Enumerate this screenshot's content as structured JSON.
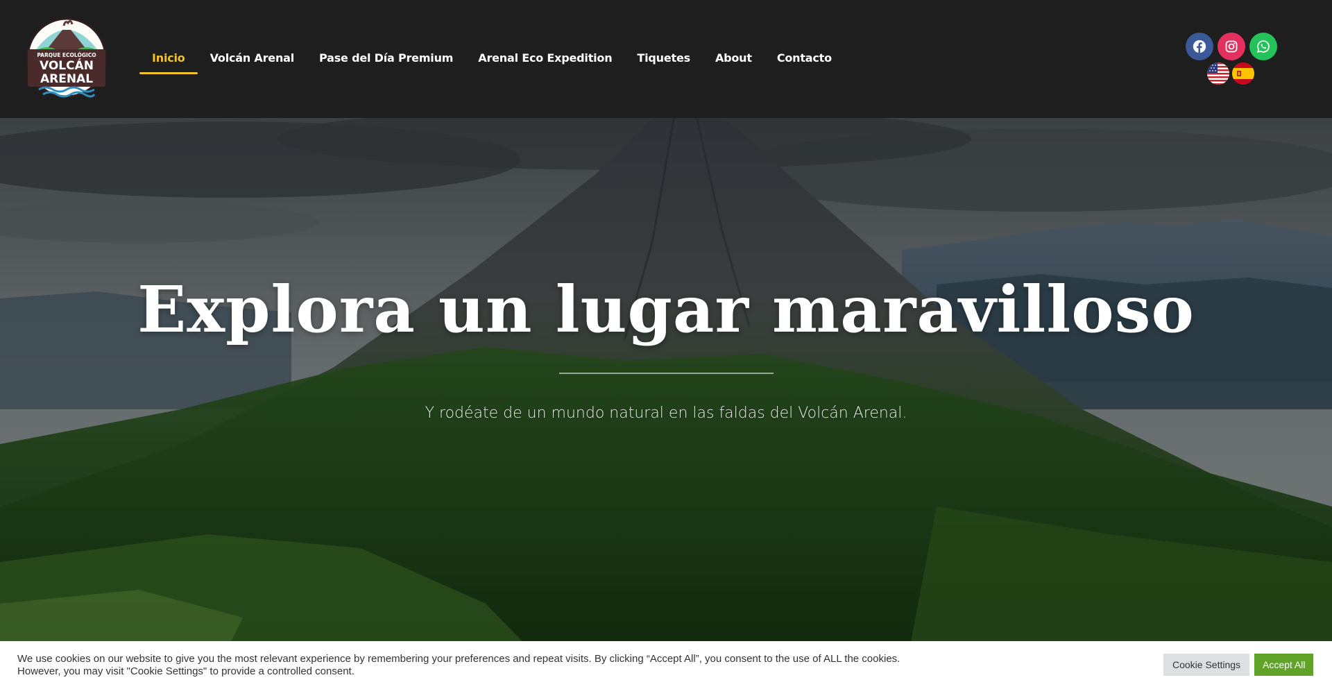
{
  "logo": {
    "line1": "PARQUE ECOLÓGICO",
    "line2": "VOLCÁN",
    "line3": "ARENAL"
  },
  "nav": {
    "items": [
      {
        "label": "Inicio",
        "active": true
      },
      {
        "label": "Volcán Arenal",
        "active": false
      },
      {
        "label": "Pase del Día Premium",
        "active": false
      },
      {
        "label": "Arenal Eco Expedition",
        "active": false
      },
      {
        "label": "Tiquetes",
        "active": false
      },
      {
        "label": "About",
        "active": false
      },
      {
        "label": "Contacto",
        "active": false
      }
    ],
    "active_color": "#f2c230"
  },
  "social": {
    "icons": [
      "facebook-icon",
      "instagram-icon",
      "whatsapp-icon"
    ],
    "colors": {
      "facebook": "#3b5998",
      "instagram": "#e4305f",
      "whatsapp": "#25c15b"
    }
  },
  "languages": [
    "english-flag-icon",
    "spanish-flag-icon"
  ],
  "hero": {
    "title": "Explora un lugar maravilloso",
    "subtitle": "Y rodéate de un mundo natural en las faldas del Volcán Arenal."
  },
  "cookie": {
    "text": "We use cookies on our website to give you the most relevant experience by remembering your preferences and repeat visits. By clicking “Accept All”, you consent to the use of ALL the cookies. However, you may visit \"Cookie Settings\" to provide a controlled consent.",
    "settings_label": "Cookie Settings",
    "accept_label": "Accept All",
    "accept_color": "#61a229"
  }
}
